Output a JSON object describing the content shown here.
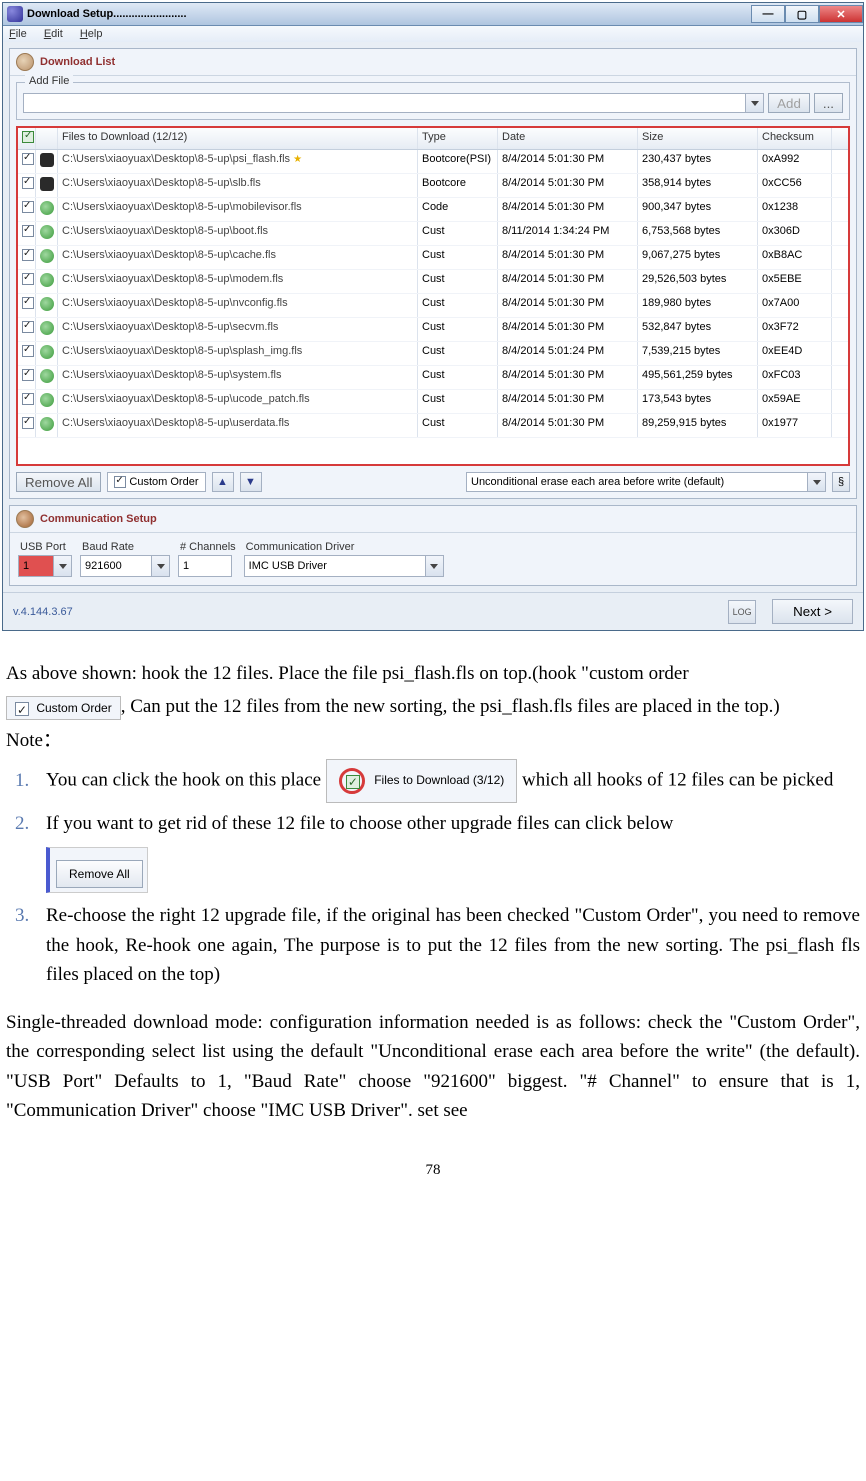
{
  "window": {
    "title": "Download Setup........................",
    "menu": {
      "file": "File",
      "edit": "Edit",
      "help": "Help"
    }
  },
  "download_list": {
    "title": "Download List",
    "addfile_legend": "Add File",
    "add_btn": "Add",
    "browse_btn": "...",
    "columns": {
      "files": "Files to Download (12/12)",
      "type": "Type",
      "date": "Date",
      "size": "Size",
      "checksum": "Checksum"
    },
    "rows": [
      {
        "icon": "dark",
        "file": "C:\\Users\\xiaoyuax\\Desktop\\8-5-up\\psi_flash.fls",
        "star": true,
        "type": "Bootcore(PSI)",
        "date": "8/4/2014 5:01:30 PM",
        "size": "230,437 bytes",
        "checksum": "0xA992"
      },
      {
        "icon": "dark",
        "file": "C:\\Users\\xiaoyuax\\Desktop\\8-5-up\\slb.fls",
        "star": false,
        "type": "Bootcore",
        "date": "8/4/2014 5:01:30 PM",
        "size": "358,914 bytes",
        "checksum": "0xCC56"
      },
      {
        "icon": "globe",
        "file": "C:\\Users\\xiaoyuax\\Desktop\\8-5-up\\mobilevisor.fls",
        "star": false,
        "type": "Code",
        "date": "8/4/2014 5:01:30 PM",
        "size": "900,347 bytes",
        "checksum": "0x1238"
      },
      {
        "icon": "globe",
        "file": "C:\\Users\\xiaoyuax\\Desktop\\8-5-up\\boot.fls",
        "star": false,
        "type": "Cust",
        "date": "8/11/2014 1:34:24 PM",
        "size": "6,753,568 bytes",
        "checksum": "0x306D"
      },
      {
        "icon": "globe",
        "file": "C:\\Users\\xiaoyuax\\Desktop\\8-5-up\\cache.fls",
        "star": false,
        "type": "Cust",
        "date": "8/4/2014 5:01:30 PM",
        "size": "9,067,275 bytes",
        "checksum": "0xB8AC"
      },
      {
        "icon": "globe",
        "file": "C:\\Users\\xiaoyuax\\Desktop\\8-5-up\\modem.fls",
        "star": false,
        "type": "Cust",
        "date": "8/4/2014 5:01:30 PM",
        "size": "29,526,503 bytes",
        "checksum": "0x5EBE"
      },
      {
        "icon": "globe",
        "file": "C:\\Users\\xiaoyuax\\Desktop\\8-5-up\\nvconfig.fls",
        "star": false,
        "type": "Cust",
        "date": "8/4/2014 5:01:30 PM",
        "size": "189,980 bytes",
        "checksum": "0x7A00"
      },
      {
        "icon": "globe",
        "file": "C:\\Users\\xiaoyuax\\Desktop\\8-5-up\\secvm.fls",
        "star": false,
        "type": "Cust",
        "date": "8/4/2014 5:01:30 PM",
        "size": "532,847 bytes",
        "checksum": "0x3F72"
      },
      {
        "icon": "globe",
        "file": "C:\\Users\\xiaoyuax\\Desktop\\8-5-up\\splash_img.fls",
        "star": false,
        "type": "Cust",
        "date": "8/4/2014 5:01:24 PM",
        "size": "7,539,215 bytes",
        "checksum": "0xEE4D"
      },
      {
        "icon": "globe",
        "file": "C:\\Users\\xiaoyuax\\Desktop\\8-5-up\\system.fls",
        "star": false,
        "type": "Cust",
        "date": "8/4/2014 5:01:30 PM",
        "size": "495,561,259 bytes",
        "checksum": "0xFC03"
      },
      {
        "icon": "globe",
        "file": "C:\\Users\\xiaoyuax\\Desktop\\8-5-up\\ucode_patch.fls",
        "star": false,
        "type": "Cust",
        "date": "8/4/2014 5:01:30 PM",
        "size": "173,543 bytes",
        "checksum": "0x59AE"
      },
      {
        "icon": "globe",
        "file": "C:\\Users\\xiaoyuax\\Desktop\\8-5-up\\userdata.fls",
        "star": false,
        "type": "Cust",
        "date": "8/4/2014 5:01:30 PM",
        "size": "89,259,915 bytes",
        "checksum": "0x1977"
      }
    ],
    "remove_all": "Remove All",
    "custom_order": "Custom Order",
    "erase_mode": "Unconditional erase each area before write (default)"
  },
  "comm": {
    "title": "Communication Setup",
    "usb_port_label": "USB Port",
    "usb_port_value": "1",
    "baud_label": "Baud Rate",
    "baud_value": "921600",
    "channels_label": "# Channels",
    "channels_value": "1",
    "driver_label": "Communication Driver",
    "driver_value": "IMC USB Driver"
  },
  "footer": {
    "version": "v.4.144.3.67",
    "log": "LOG",
    "next": "Next >"
  },
  "doc": {
    "p1a": "As above shown: hook the 12 files. Place the file psi_flash.fls on top.(hook \"custom order",
    "custom_order_img": "Custom Order",
    "p1b": ", Can put the 12 files from the new sorting, the psi_flash.fls files are placed in the top.)",
    "note": "Note：",
    "li1a": "You can click the hook on this place ",
    "files_to_dl_img": "Files to Download (3/12)",
    "li1b": " which all hooks of 12 files can be picked",
    "li2": " If you want to get rid of these 12 file to choose other upgrade files can click below",
    "remove_all_img": "Remove All",
    "li3": " Re-choose the right 12 upgrade file, if the original has been checked \"Custom Order\", you need to remove the hook, Re-hook one again, The purpose is to put the 12 files from the new sorting. The psi_flash fls files placed on the top)",
    "p2": "Single-threaded download mode: configuration information needed is as follows: check the \"Custom Order\", the corresponding select list using the default \"Unconditional erase each area before the write\" (the default). \"USB Port\" Defaults to 1, \"Baud Rate\" choose \"921600\" biggest. \"# Channel\" to ensure that is 1, \"Communication Driver\" choose \"IMC USB Driver\". set see",
    "pagenum": "78"
  }
}
